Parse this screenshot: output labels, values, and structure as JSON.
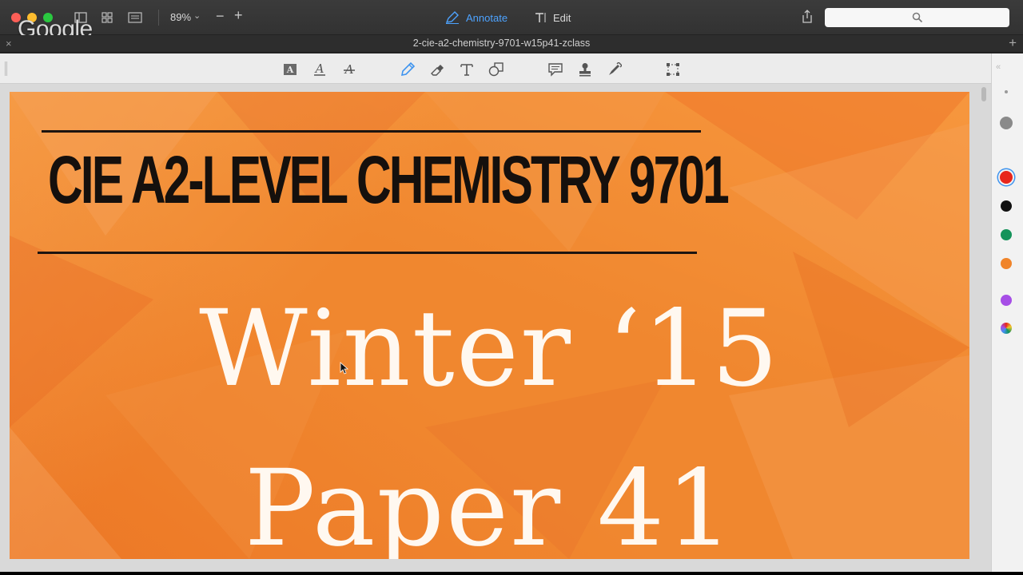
{
  "toolbar": {
    "zoom": "89%",
    "annotate_label": "Annotate",
    "edit_label": "Edit",
    "search_placeholder": ""
  },
  "overlay": {
    "google_logo": "Google"
  },
  "tab": {
    "title": "2-cie-a2-chemistry-9701-w15p41-zclass"
  },
  "document": {
    "heading": "CIE A2-LEVEL CHEMISTRY 9701",
    "line1": "Winter ‘15",
    "line2": "Paper 41"
  },
  "annotation_tools": [
    "text-highlight-icon",
    "text-underline-icon",
    "text-strikethrough-icon",
    "pencil-icon",
    "eraser-icon",
    "text-box-icon",
    "shapes-icon",
    "note-icon",
    "stamp-icon",
    "signature-icon",
    "selection-icon"
  ],
  "colors": {
    "selected": "#e8261c",
    "palette": [
      "#888888",
      "#e8261c",
      "#111111",
      "#14935a",
      "#f0842a",
      "#a64ee6"
    ],
    "accent": "#4da3ff",
    "page_background": "#f0872f"
  }
}
